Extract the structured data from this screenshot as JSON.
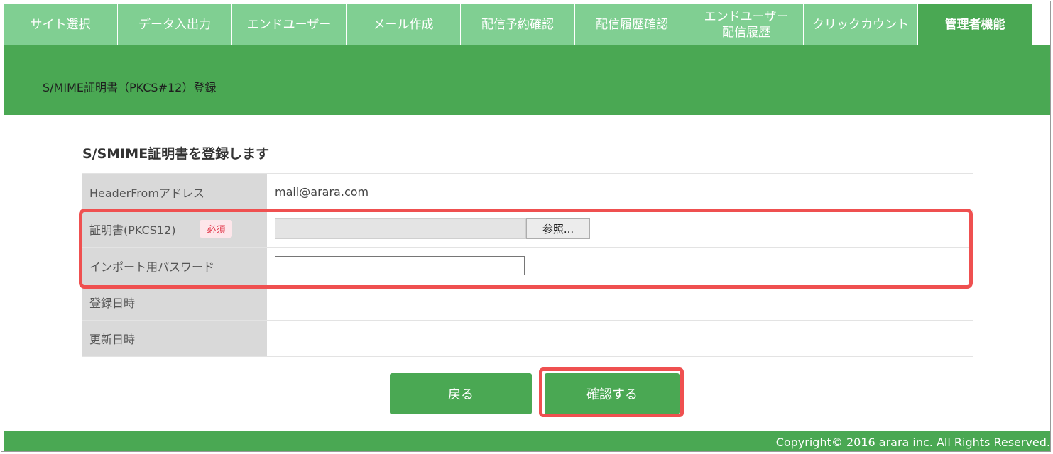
{
  "nav": {
    "tabs": [
      {
        "label": "サイト選択",
        "active": false
      },
      {
        "label": "データ入出力",
        "active": false
      },
      {
        "label": "エンドユーザー",
        "active": false
      },
      {
        "label": "メール作成",
        "active": false
      },
      {
        "label": "配信予約確認",
        "active": false
      },
      {
        "label": "配信履歴確認",
        "active": false
      },
      {
        "label": "エンドユーザー\n配信履歴",
        "active": false
      },
      {
        "label": "クリックカウント",
        "active": false
      },
      {
        "label": "管理者機能",
        "active": true
      }
    ]
  },
  "page": {
    "title": "S/MIME証明書（PKCS#12）登録",
    "section_heading": "S/SMIME証明書を登録します"
  },
  "form": {
    "header_from_label": "HeaderFromアドレス",
    "header_from_value": "mail@arara.com",
    "cert_label": "証明書(PKCS12)",
    "required_badge": "必須",
    "cert_file_value": "",
    "browse_label": "参照...",
    "password_label": "インポート用パスワード",
    "password_value": "",
    "registered_label": "登録日時",
    "registered_value": "",
    "updated_label": "更新日時",
    "updated_value": ""
  },
  "actions": {
    "back_label": "戻る",
    "confirm_label": "確認する"
  },
  "footer": {
    "copyright": "Copyright© 2016 arara inc. All Rights Reserved."
  },
  "colors": {
    "brand_green": "#4aa853",
    "tab_green": "#80cf92",
    "highlight_red": "#ef5050",
    "required_red": "#e23a4c"
  }
}
